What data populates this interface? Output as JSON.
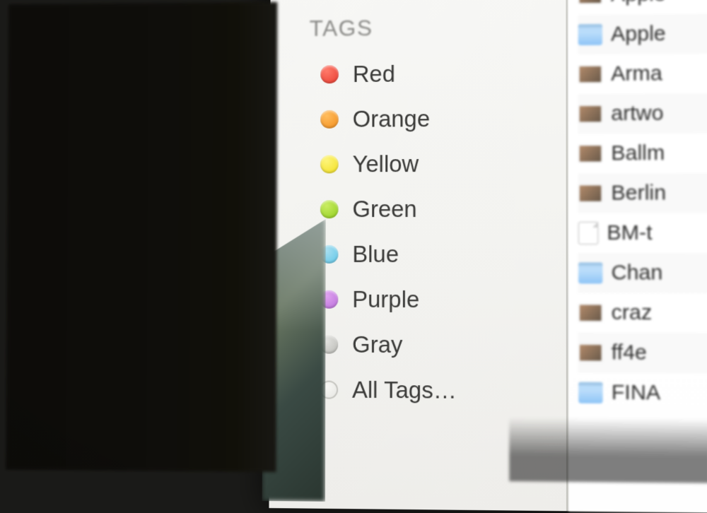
{
  "sidebar": {
    "section_label": "TAGS",
    "tags": [
      {
        "label": "Red",
        "color_class": "red"
      },
      {
        "label": "Orange",
        "color_class": "orange"
      },
      {
        "label": "Yellow",
        "color_class": "yellow"
      },
      {
        "label": "Green",
        "color_class": "green"
      },
      {
        "label": "Blue",
        "color_class": "blue"
      },
      {
        "label": "Purple",
        "color_class": "purple"
      },
      {
        "label": "Gray",
        "color_class": "gray"
      },
      {
        "label": "All Tags…",
        "color_class": "all"
      }
    ]
  },
  "files": [
    {
      "name": "Apple",
      "icon": "image"
    },
    {
      "name": "Apple",
      "icon": "folder"
    },
    {
      "name": "Arma",
      "icon": "image"
    },
    {
      "name": "artwo",
      "icon": "image"
    },
    {
      "name": "Ballm",
      "icon": "image"
    },
    {
      "name": "Berlin",
      "icon": "image"
    },
    {
      "name": "BM-t",
      "icon": "doc"
    },
    {
      "name": "Chan",
      "icon": "folder"
    },
    {
      "name": "craz",
      "icon": "image"
    },
    {
      "name": "ff4e",
      "icon": "image"
    },
    {
      "name": "FINA",
      "icon": "folder"
    }
  ]
}
